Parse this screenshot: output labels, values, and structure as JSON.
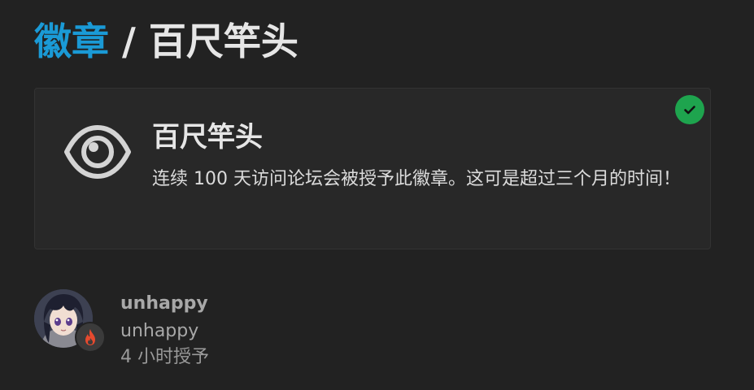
{
  "breadcrumb": {
    "parent_label": "徽章",
    "separator": " / ",
    "current_label": "百尺竿头"
  },
  "badge": {
    "name": "百尺竿头",
    "description": "连续 100 天访问论坛会被授予此徽章。这可是超过三个月的时间！",
    "icon": "eye-icon",
    "granted_status_icon": "check-icon"
  },
  "grant": {
    "username": "unhappy",
    "display_name": "unhappy",
    "granted_time": "4 小时授予",
    "flair_icon": "fire-icon"
  },
  "colors": {
    "background": "#222222",
    "card": "#282828",
    "link": "#1a9ad6",
    "granted": "#1ea44e",
    "flair": "#e64a2e"
  }
}
